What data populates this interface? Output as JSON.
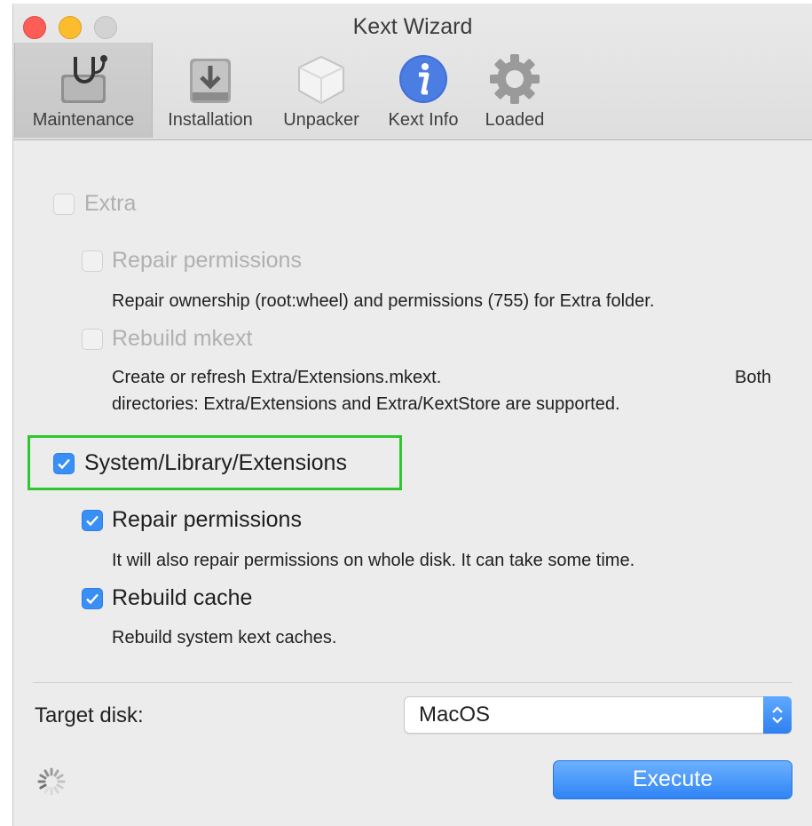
{
  "window": {
    "title": "Kext Wizard"
  },
  "toolbar": {
    "items": [
      {
        "label": "Maintenance",
        "icon": "stethoscope-drive-icon",
        "selected": true
      },
      {
        "label": "Installation",
        "icon": "install-drive-icon",
        "selected": false
      },
      {
        "label": "Unpacker",
        "icon": "package-icon",
        "selected": false
      },
      {
        "label": "Kext Info",
        "icon": "info-icon",
        "selected": false
      },
      {
        "label": "Loaded",
        "icon": "gear-icon",
        "selected": false
      }
    ]
  },
  "extra": {
    "label": "Extra",
    "checked": false,
    "enabled": false,
    "repair": {
      "label": "Repair permissions",
      "checked": false,
      "description": "Repair ownership (root:wheel) and permissions (755) for Extra folder."
    },
    "rebuild": {
      "label": "Rebuild mkext",
      "checked": false,
      "description_line1": "Create or refresh Extra/Extensions.mkext.",
      "description_line1_end": "Both",
      "description_line2": "directories: Extra/Extensions and Extra/KextStore are supported."
    }
  },
  "system": {
    "label": "System/Library/Extensions",
    "checked": true,
    "repair": {
      "label": "Repair permissions",
      "checked": true,
      "description": "It will also repair permissions on whole disk. It can take some time."
    },
    "rebuild": {
      "label": "Rebuild cache",
      "checked": true,
      "description": "Rebuild system kext caches."
    }
  },
  "target_disk": {
    "label": "Target disk:",
    "value": "MacOS"
  },
  "actions": {
    "execute_label": "Execute"
  },
  "colors": {
    "accent": "#3a8ff5",
    "highlight": "#2ec82e",
    "close": "#fc5d57",
    "minimize": "#fdbc2e",
    "zoom": "#d3d3d3"
  }
}
